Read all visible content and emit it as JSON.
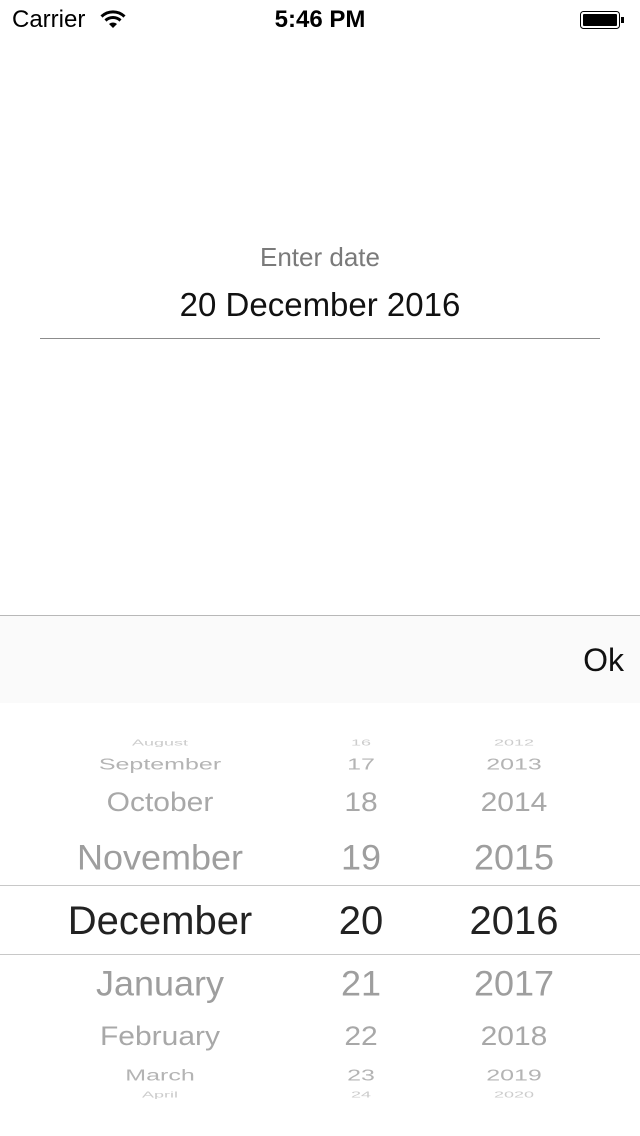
{
  "status_bar": {
    "carrier": "Carrier",
    "time": "5:46 PM",
    "wifi_icon": "wifi-icon",
    "battery_icon": "battery-icon"
  },
  "form": {
    "label": "Enter date",
    "value": "20 December 2016"
  },
  "toolbar": {
    "ok_label": "Ok"
  },
  "picker": {
    "months": [
      "August",
      "September",
      "October",
      "November",
      "December",
      "January",
      "February",
      "March",
      "April"
    ],
    "days": [
      "16",
      "17",
      "18",
      "19",
      "20",
      "21",
      "22",
      "23",
      "24"
    ],
    "years": [
      "2012",
      "2013",
      "2014",
      "2015",
      "2016",
      "2017",
      "2018",
      "2019",
      "2020"
    ],
    "selected": {
      "month": "December",
      "day": "20",
      "year": "2016"
    }
  }
}
